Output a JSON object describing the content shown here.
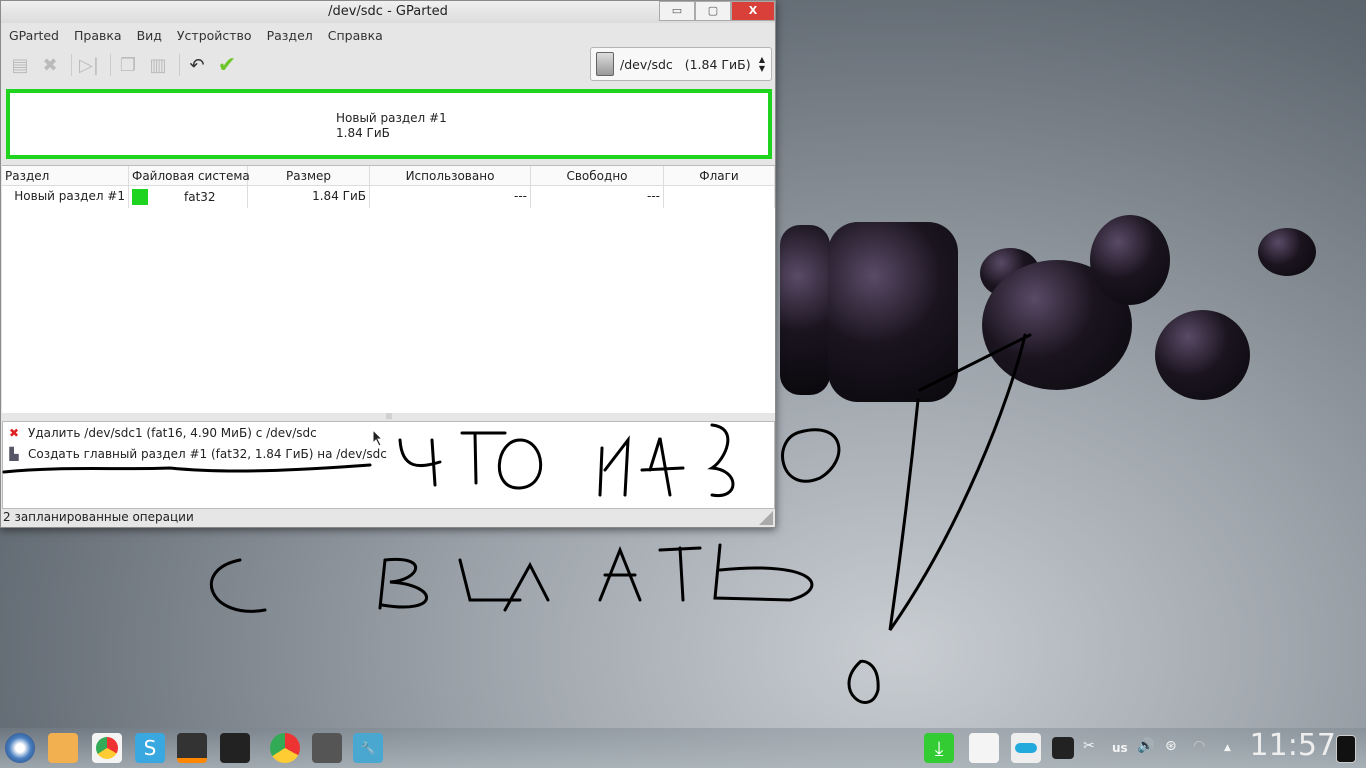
{
  "window": {
    "title": "/dev/sdc - GParted",
    "controls": {
      "minimize": "▭",
      "maximize": "▢",
      "close": "X"
    }
  },
  "menu": [
    "GParted",
    "Правка",
    "Вид",
    "Устройство",
    "Раздел",
    "Справка"
  ],
  "toolbar": {
    "icons": [
      "new-partition-icon",
      "delete-icon",
      "resize-icon",
      "copy-icon",
      "paste-icon",
      "undo-icon",
      "apply-icon"
    ]
  },
  "device": {
    "name": "/dev/sdc",
    "size": "(1.84 ГиБ)"
  },
  "graph": {
    "name": "Новый раздел #1",
    "size": "1.84 ГиБ",
    "color": "#1fd41f"
  },
  "table": {
    "headers": [
      "Раздел",
      "Файловая система",
      "Размер",
      "Использовано",
      "Свободно",
      "Флаги"
    ],
    "rows": [
      {
        "partition": "Новый раздел #1",
        "fs": "fat32",
        "size": "1.84 ГиБ",
        "used": "---",
        "free": "---",
        "flags": "",
        "fs_color": "#1fd41f"
      }
    ]
  },
  "operations": [
    "Удалить /dev/sdc1 (fat16, 4.90 МиБ) с /dev/sdc",
    "Создать главный раздел #1 (fat32, 1.84 ГиБ) на /dev/sdc"
  ],
  "status": "2 запланированные операции",
  "handwriting": "что надо сделать",
  "taskbar": {
    "apps": [
      "menu",
      "file-manager",
      "chrome",
      "skype",
      "media-player",
      "audio",
      "chrome",
      "terminal-app",
      "settings"
    ],
    "tray": {
      "keyboard": "us",
      "clock": "11:57"
    }
  }
}
